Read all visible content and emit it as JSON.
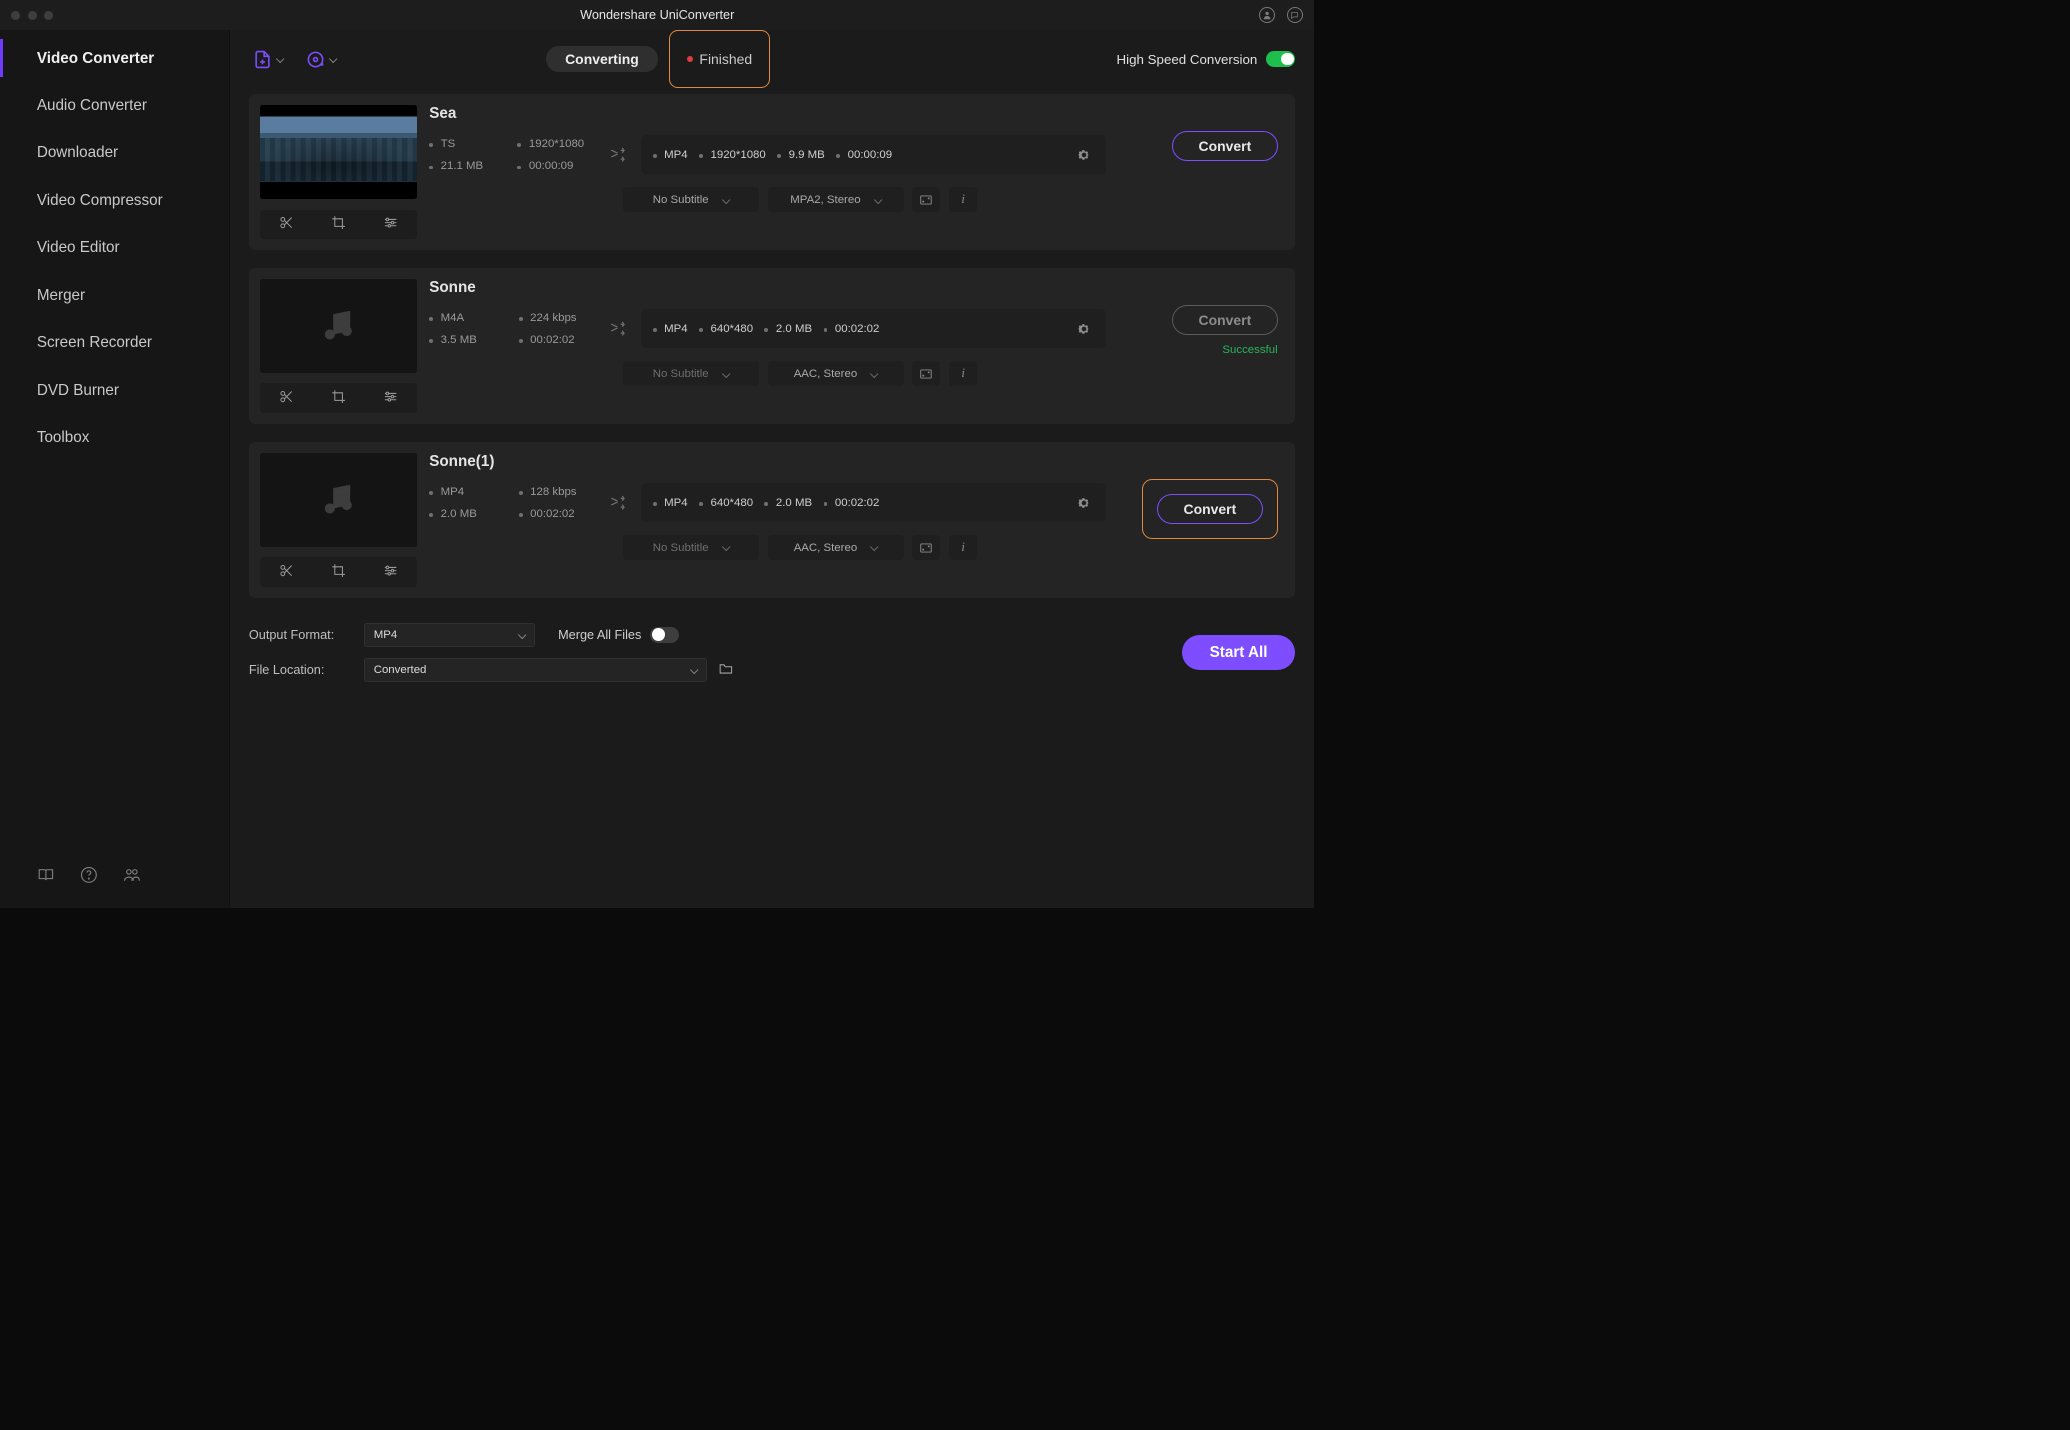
{
  "titlebar": {
    "title": "Wondershare UniConverter"
  },
  "sidebar": {
    "items": [
      "Video Converter",
      "Audio Converter",
      "Downloader",
      "Video Compressor",
      "Video Editor",
      "Merger",
      "Screen Recorder",
      "DVD Burner",
      "Toolbox"
    ],
    "active_index": 0
  },
  "topbar": {
    "tab_converting": "Converting",
    "tab_finished": "Finished",
    "hs_label": "High Speed Conversion",
    "hs_on": true
  },
  "items": [
    {
      "name": "Sea",
      "src": {
        "fmt": "TS",
        "res": "1920*1080",
        "size": "21.1 MB",
        "dur": "00:00:09"
      },
      "out": {
        "fmt": "MP4",
        "res": "1920*1080",
        "size": "9.9 MB",
        "dur": "00:00:09"
      },
      "subtitle": "No Subtitle",
      "audio": "MPA2, Stereo",
      "subtitle_enabled": true,
      "status": "",
      "convert_enabled": true,
      "highlight": false,
      "thumb": "sea"
    },
    {
      "name": "Sonne",
      "src": {
        "fmt": "M4A",
        "res": "224 kbps",
        "size": "3.5 MB",
        "dur": "00:02:02"
      },
      "out": {
        "fmt": "MP4",
        "res": "640*480",
        "size": "2.0 MB",
        "dur": "00:02:02"
      },
      "subtitle": "No Subtitle",
      "audio": "AAC, Stereo",
      "subtitle_enabled": false,
      "status": "Successful",
      "convert_enabled": false,
      "highlight": false,
      "thumb": "music"
    },
    {
      "name": "Sonne(1)",
      "src": {
        "fmt": "MP4",
        "res": "128 kbps",
        "size": "2.0 MB",
        "dur": "00:02:02"
      },
      "out": {
        "fmt": "MP4",
        "res": "640*480",
        "size": "2.0 MB",
        "dur": "00:02:02"
      },
      "subtitle": "No Subtitle",
      "audio": "AAC, Stereo",
      "subtitle_enabled": false,
      "status": "",
      "convert_enabled": true,
      "highlight": true,
      "thumb": "music"
    }
  ],
  "labels": {
    "convert": "Convert"
  },
  "bottombar": {
    "output_format_label": "Output Format:",
    "output_format_value": "MP4",
    "file_location_label": "File Location:",
    "file_location_value": "Converted",
    "merge_label": "Merge All Files",
    "merge_on": false,
    "start_all": "Start All"
  }
}
